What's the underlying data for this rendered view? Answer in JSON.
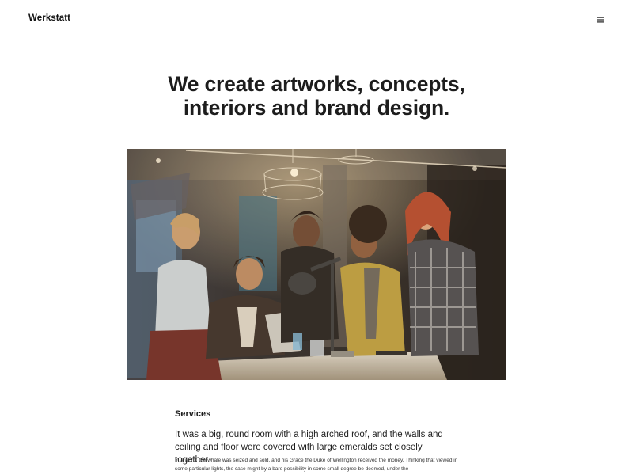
{
  "header": {
    "logo": "Werkstatt",
    "menu_icon": "hamburger-menu-icon"
  },
  "hero": {
    "title_line1": "We create artworks, concepts,",
    "title_line2": "interiors and brand design.",
    "image_subject": "team-meeting-photo"
  },
  "services": {
    "heading": "Services",
    "lead": "It was a big, round room with a high arched roof, and the walls and ceiling and floor were covered with large emeralds set closely together.",
    "body": "In a word, the whale was seized and sold, and his Grace the Duke of Wellington received the money. Thinking that viewed in some particular lights, the case might by a bare possibility in some small degree be deemed, under the"
  },
  "colors": {
    "background": "#ffffff",
    "text": "#1b1b1b"
  }
}
